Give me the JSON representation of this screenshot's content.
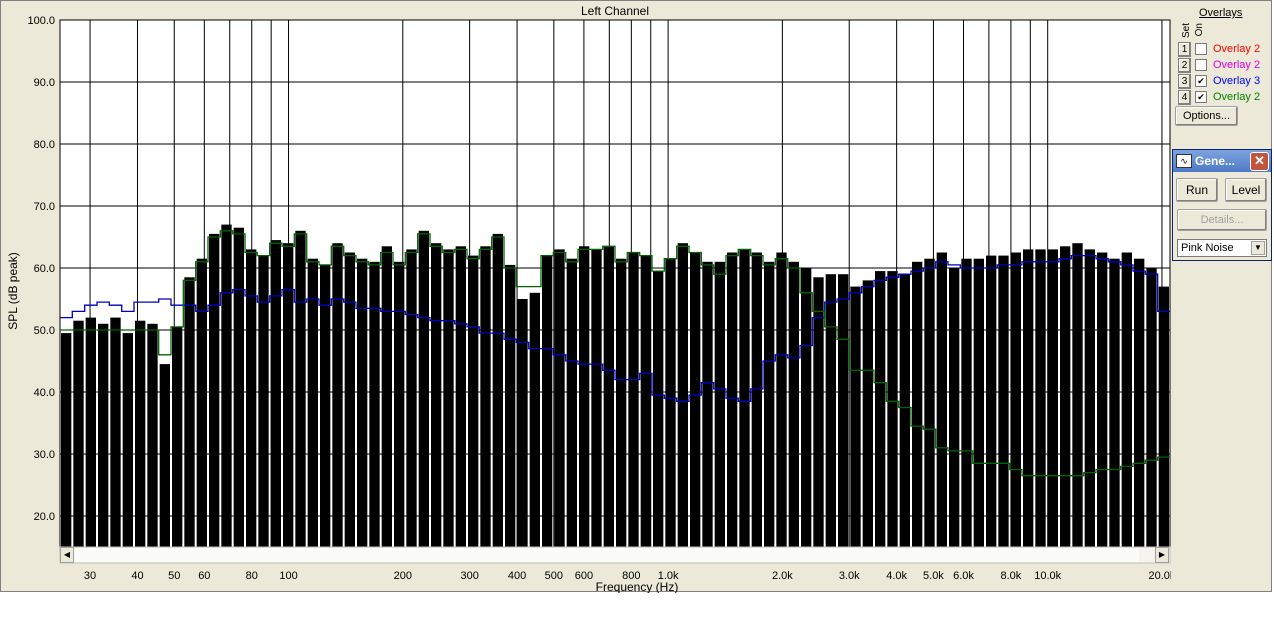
{
  "chart": {
    "title": "Left Channel",
    "ylabel": "SPL (dB peak)",
    "xlabel": "Frequency (Hz)",
    "ytick_labels": [
      "100.0",
      "90.0",
      "80.0",
      "70.0",
      "60.0",
      "50.0",
      "40.0",
      "30.0",
      "20.0"
    ],
    "xtick_labels": [
      {
        "f": 30,
        "label": "30"
      },
      {
        "f": 40,
        "label": "40"
      },
      {
        "f": 50,
        "label": "50"
      },
      {
        "f": 60,
        "label": "60"
      },
      {
        "f": 80,
        "label": "80"
      },
      {
        "f": 100,
        "label": "100"
      },
      {
        "f": 200,
        "label": "200"
      },
      {
        "f": 300,
        "label": "300"
      },
      {
        "f": 400,
        "label": "400"
      },
      {
        "f": 500,
        "label": "500"
      },
      {
        "f": 600,
        "label": "600"
      },
      {
        "f": 800,
        "label": "800"
      },
      {
        "f": 1000,
        "label": "1.0k"
      },
      {
        "f": 2000,
        "label": "2.0k"
      },
      {
        "f": 3000,
        "label": "3.0k"
      },
      {
        "f": 4000,
        "label": "4.0k"
      },
      {
        "f": 5000,
        "label": "5.0k"
      },
      {
        "f": 6000,
        "label": "6.0k"
      },
      {
        "f": 8000,
        "label": "8.0k"
      },
      {
        "f": 10000,
        "label": "10.0k"
      },
      {
        "f": 20000,
        "label": "20.0k"
      }
    ]
  },
  "chart_data": {
    "type": "bar",
    "title": "Left Channel",
    "xlabel": "Frequency (Hz)",
    "ylabel": "SPL (dB peak)",
    "x_scale": "log",
    "xlim": [
      25,
      21000
    ],
    "ylim": [
      15,
      100
    ],
    "grid": true,
    "bars_db": [
      49.5,
      51.5,
      52,
      51,
      52,
      49.5,
      51.5,
      51,
      44.5,
      50.5,
      58.5,
      61.5,
      65.5,
      67,
      66.5,
      63,
      62,
      64.5,
      64,
      66,
      61.5,
      60.5,
      64,
      62.5,
      61.5,
      61,
      63.5,
      61,
      63,
      66,
      64,
      63,
      63.5,
      62,
      63.5,
      65.5,
      60.5,
      55,
      56,
      62,
      63,
      61.5,
      63.5,
      63,
      63.5,
      61.5,
      62.5,
      62,
      59.5,
      61.5,
      64,
      62.5,
      61,
      61,
      62.5,
      63,
      62.5,
      61,
      62.5,
      61,
      60,
      58.5,
      59,
      59,
      57,
      58,
      59.5,
      59.5,
      59,
      61,
      61.5,
      62.5,
      60,
      61.5,
      61.5,
      62,
      62,
      62.5,
      63,
      63,
      63,
      63.5,
      64,
      63,
      62.5,
      61.5,
      62.5,
      61.5,
      60,
      57
    ],
    "series": [
      {
        "name": "Overlay 3",
        "color": "#0000c0",
        "values": [
          52,
          53,
          54,
          54.5,
          54,
          53,
          54.5,
          54.5,
          55,
          54,
          54,
          53,
          54,
          56,
          56.5,
          55.5,
          54.5,
          55.5,
          56.5,
          54.5,
          55,
          54,
          55,
          54.5,
          53.5,
          53.5,
          53,
          53,
          52.5,
          52,
          51.5,
          51.5,
          51,
          50.5,
          49.5,
          49.5,
          48.5,
          48,
          47,
          47,
          46,
          45,
          44.5,
          44.5,
          43.5,
          42,
          42,
          43,
          39.5,
          39,
          38.5,
          39.5,
          41.5,
          40.5,
          39,
          38.5,
          40.5,
          45,
          46,
          45.5,
          47.5,
          52,
          54.5,
          55,
          56,
          57,
          58,
          58.5,
          59,
          59.5,
          60,
          61,
          60.5,
          60,
          60,
          60,
          60.5,
          60.5,
          61,
          61,
          61,
          61.5,
          62,
          62,
          61.5,
          61,
          60.5,
          59.5,
          59,
          53
        ]
      },
      {
        "name": "Overlay 2",
        "color": "#006400",
        "values": [
          50,
          50,
          50,
          50,
          50,
          50,
          50,
          50,
          46,
          50.5,
          58,
          61,
          65,
          66,
          65.5,
          62.5,
          62,
          64,
          63.5,
          65.5,
          61,
          60.5,
          63.5,
          62,
          61,
          60.5,
          62.5,
          60.5,
          62.5,
          65.5,
          63.5,
          62.5,
          63,
          61.5,
          63,
          65,
          60,
          57,
          57,
          62,
          62.5,
          61,
          63,
          63,
          63.5,
          61,
          62.5,
          62,
          59.5,
          61.5,
          63.5,
          62.5,
          60.5,
          59,
          62,
          63,
          62,
          60.5,
          61.5,
          60,
          56,
          53,
          50.5,
          48.5,
          43.5,
          43.5,
          41.5,
          38.5,
          37.5,
          34.5,
          34,
          31,
          30.5,
          30.5,
          28.5,
          28.5,
          28.5,
          27.5,
          26.5,
          26.5,
          26.5,
          26.5,
          26.5,
          27,
          27.5,
          27.5,
          28,
          28.5,
          29,
          29.5
        ]
      }
    ]
  },
  "overlays_panel": {
    "title": "Overlays",
    "set_label": "Set",
    "on_label": "On",
    "rows": [
      {
        "num": "1",
        "checked": false,
        "check_mark": "",
        "label": "Overlay 2",
        "color": "#ff0000"
      },
      {
        "num": "2",
        "checked": false,
        "check_mark": "",
        "label": "Overlay 2",
        "color": "#e000e0"
      },
      {
        "num": "3",
        "checked": true,
        "check_mark": "✔",
        "label": "Overlay 3",
        "color": "#0000ff"
      },
      {
        "num": "4",
        "checked": true,
        "check_mark": "✔",
        "label": "Overlay 2",
        "color": "#008000"
      }
    ],
    "options_label": "Options..."
  },
  "generator": {
    "title": "Gene...",
    "run_label": "Run",
    "level_label": "Level",
    "details_label": "Details...",
    "signal": "Pink Noise"
  },
  "icons": [
    "close-icon",
    "generator-icon",
    "scroll-left-icon",
    "scroll-right-icon",
    "dropdown-arrow-icon"
  ]
}
